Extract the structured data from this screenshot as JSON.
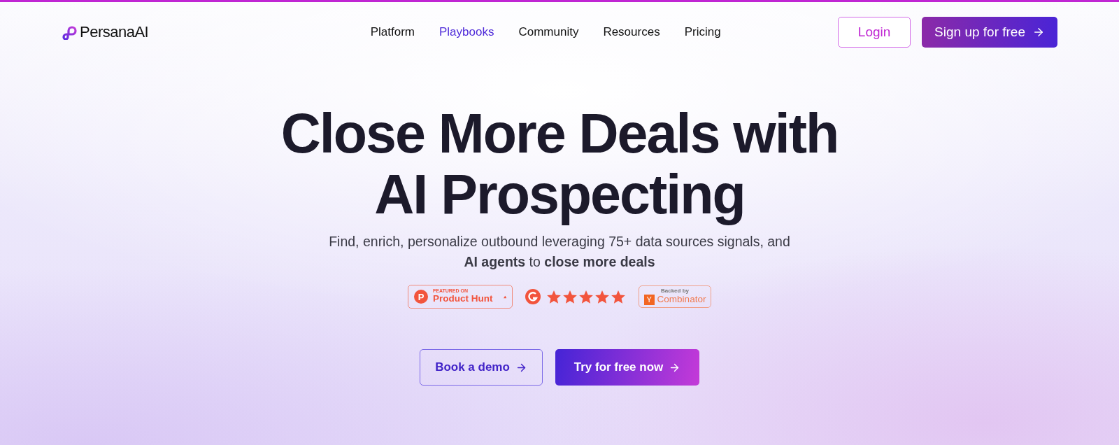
{
  "logo": {
    "text": "PersanaAI"
  },
  "nav": [
    {
      "label": "Platform",
      "selected": false
    },
    {
      "label": "Playbooks",
      "selected": true
    },
    {
      "label": "Community",
      "selected": false
    },
    {
      "label": "Resources",
      "selected": false
    },
    {
      "label": "Pricing",
      "selected": false
    }
  ],
  "header_buttons": {
    "login": "Login",
    "signup": "Sign up for free"
  },
  "hero": {
    "title_lines": [
      "Close More Deals with",
      "AI Prospecting"
    ],
    "subtitle_lines": [
      "Find, enrich, personalize outbound leveraging 75+ data sources signals, and",
      "**AI agents** to **close more deals**"
    ]
  },
  "badges": {
    "product_hunt": {
      "icon_letter": "P",
      "overline": "FEATURED ON",
      "name": "Product Hunt"
    },
    "g2": {
      "stars": 5
    },
    "yc": {
      "overline": "Backed by",
      "icon_letter": "Y",
      "name": "Combinator"
    }
  },
  "cta": {
    "secondary": "Book a demo",
    "primary": "Try for free now"
  }
}
